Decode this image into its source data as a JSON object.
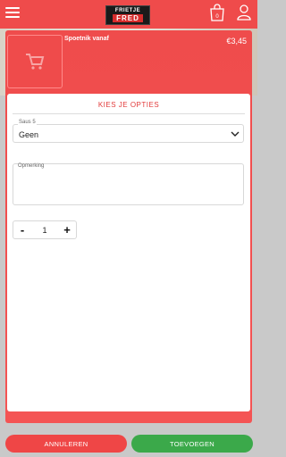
{
  "header": {
    "logo_line1": "FRIETJE",
    "logo_line2": "FRED",
    "cart_count": "0"
  },
  "product": {
    "name": "Spoetnik vanaf",
    "price": "€3,45"
  },
  "options": {
    "title": "KIES JE OPTIES",
    "sauce_label": "Saus 5",
    "sauce_value": "Geen",
    "remark_label": "Opmerking",
    "remark_value": "",
    "quantity": "1",
    "minus": "-",
    "plus": "+"
  },
  "footer": {
    "cancel_label": "ANNULEREN",
    "add_label": "TOEVOEGEN"
  },
  "colors": {
    "brand_red": "#ef4b4b",
    "accent_green": "#3ba94a"
  },
  "icons": [
    "menu-icon",
    "cart-icon",
    "user-icon",
    "cart-placeholder-icon",
    "chevron-down-icon"
  ]
}
